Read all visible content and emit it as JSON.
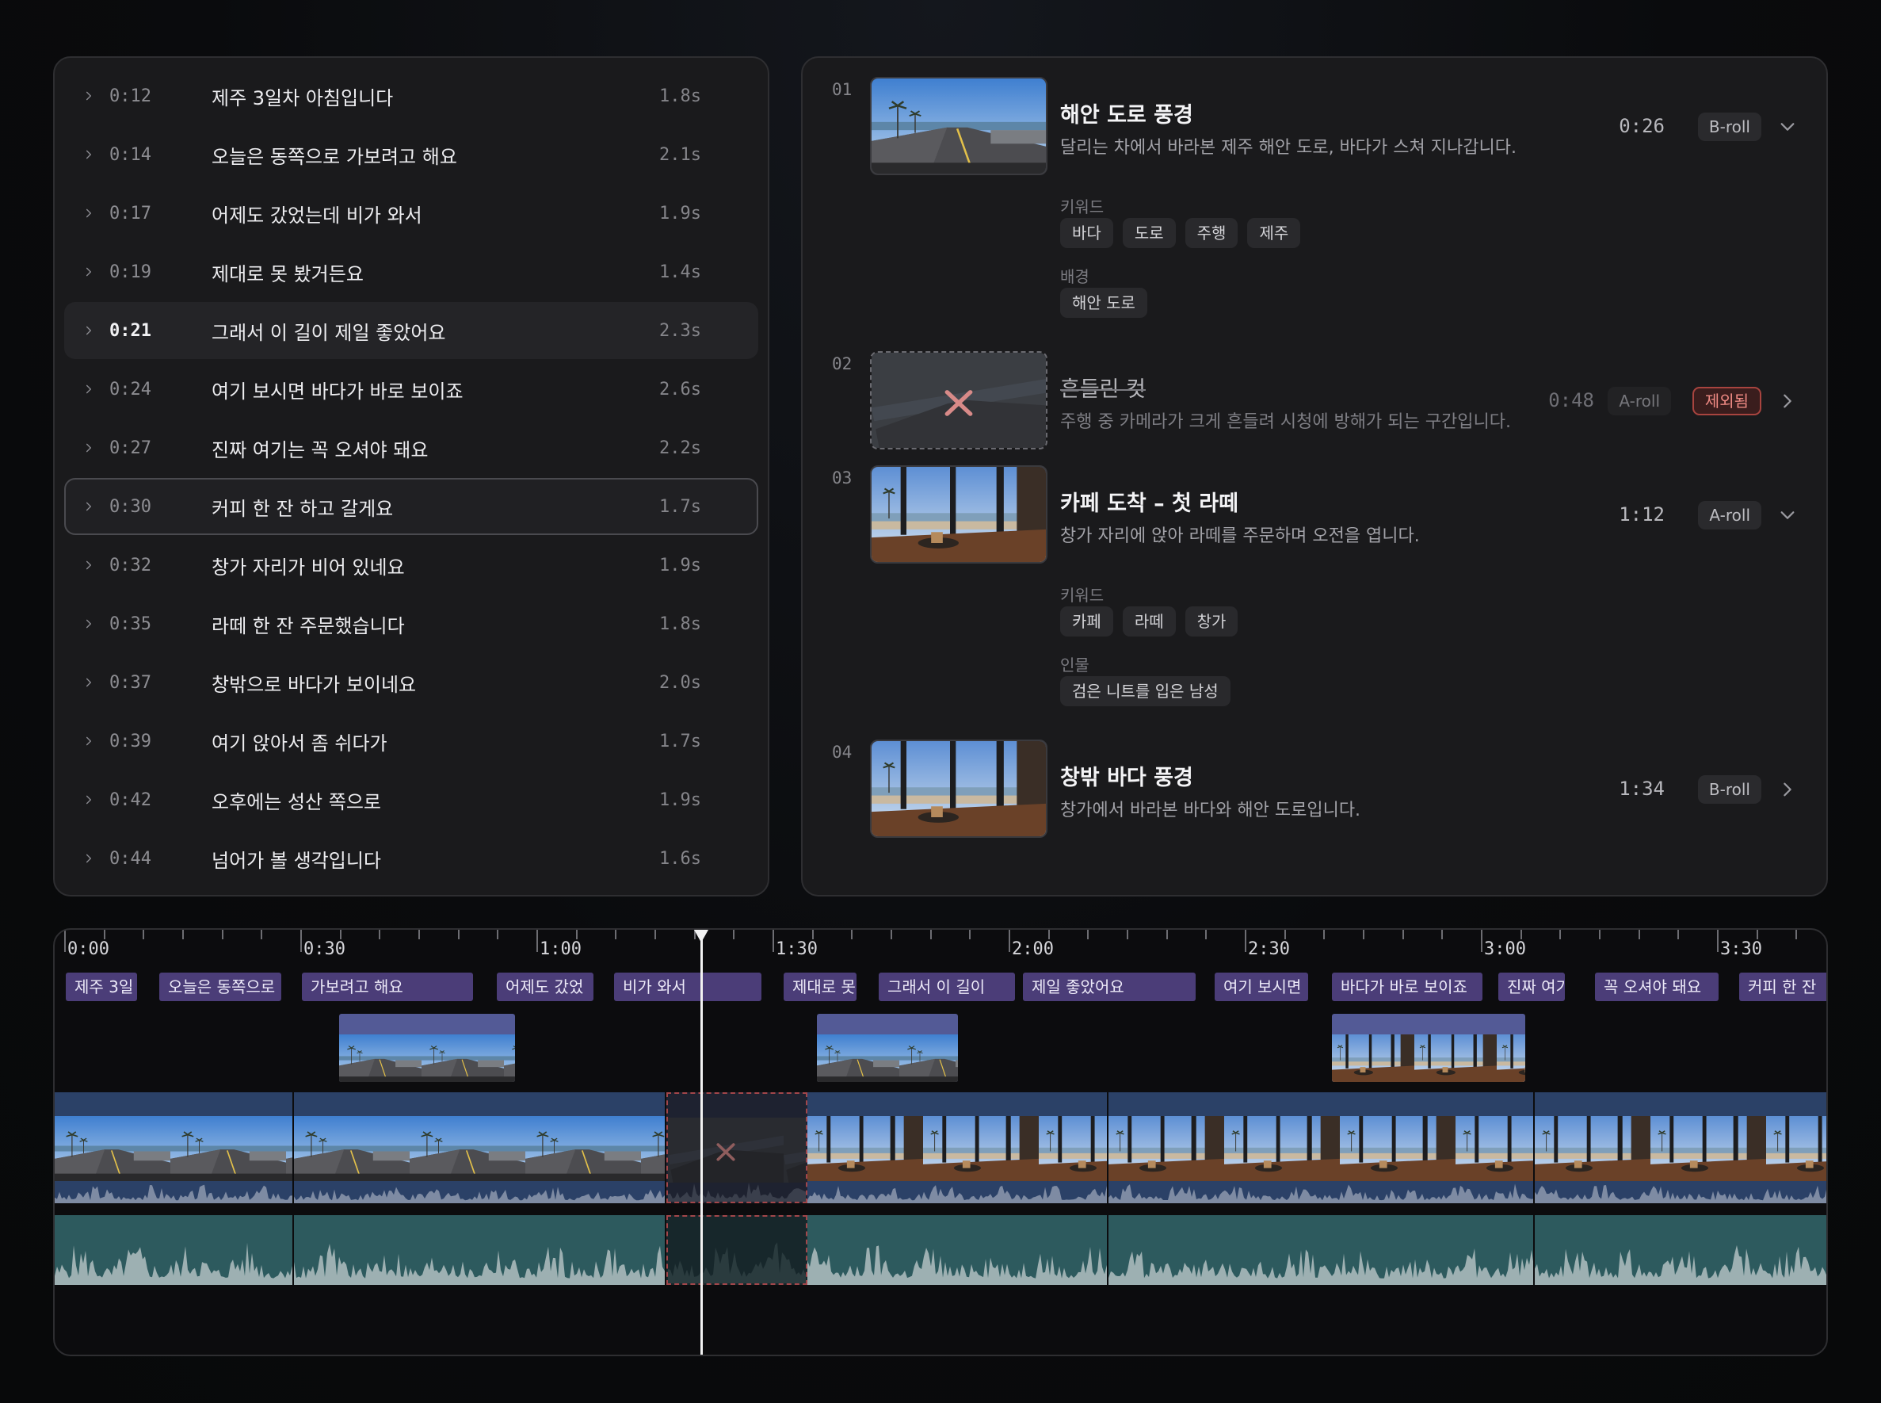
{
  "transcript": {
    "rows": [
      {
        "time": "0:12",
        "text": "제주 3일차 아침입니다",
        "dur": "1.8s",
        "state": ""
      },
      {
        "time": "0:14",
        "text": "오늘은 동쪽으로 가보려고 해요",
        "dur": "2.1s",
        "state": ""
      },
      {
        "time": "0:17",
        "text": "어제도 갔었는데 비가 와서",
        "dur": "1.9s",
        "state": ""
      },
      {
        "time": "0:19",
        "text": "제대로 못 봤거든요",
        "dur": "1.4s",
        "state": ""
      },
      {
        "time": "0:21",
        "text": "그래서 이 길이 제일 좋았어요",
        "dur": "2.3s",
        "state": "active"
      },
      {
        "time": "0:24",
        "text": "여기 보시면 바다가 바로 보이죠",
        "dur": "2.6s",
        "state": ""
      },
      {
        "time": "0:27",
        "text": "진짜 여기는 꼭 오셔야 돼요",
        "dur": "2.2s",
        "state": ""
      },
      {
        "time": "0:30",
        "text": "커피 한 잔 하고 갈게요",
        "dur": "1.7s",
        "state": "selected"
      },
      {
        "time": "0:32",
        "text": "창가 자리가 비어 있네요",
        "dur": "1.9s",
        "state": ""
      },
      {
        "time": "0:35",
        "text": "라떼 한 잔 주문했습니다",
        "dur": "1.8s",
        "state": ""
      },
      {
        "time": "0:37",
        "text": "창밖으로 바다가 보이네요",
        "dur": "2.0s",
        "state": ""
      },
      {
        "time": "0:39",
        "text": "여기 앉아서 좀 쉬다가",
        "dur": "1.7s",
        "state": ""
      },
      {
        "time": "0:42",
        "text": "오후에는 성산 쪽으로",
        "dur": "1.9s",
        "state": ""
      },
      {
        "time": "0:44",
        "text": "넘어가 볼 생각입니다",
        "dur": "1.6s",
        "state": ""
      }
    ]
  },
  "scenes": [
    {
      "num": "01",
      "title": "해안 도로 풍경",
      "desc": "달리는 차에서 바라본 제주 해안 도로, 바다가 스쳐 지나갑니다.",
      "time": "0:26",
      "type": "B-roll",
      "excluded_label": "",
      "expanded": true,
      "thumb": "road",
      "groups": [
        {
          "label": "키워드",
          "tags": [
            "바다",
            "도로",
            "주행",
            "제주"
          ]
        },
        {
          "label": "배경",
          "tags": [
            "해안 도로"
          ]
        }
      ]
    },
    {
      "num": "02",
      "title": "흔들린 컷",
      "desc": "주행 중 카메라가 크게 흔들려 시청에 방해가 되는 구간입니다.",
      "time": "0:48",
      "type": "A-roll",
      "excluded_label": "제외됨",
      "expanded": false,
      "thumb": "shaky",
      "groups": []
    },
    {
      "num": "03",
      "title": "카페 도착 – 첫 라떼",
      "desc": "창가 자리에 앉아 라떼를 주문하며 오전을 엽니다.",
      "time": "1:12",
      "type": "A-roll",
      "excluded_label": "",
      "expanded": true,
      "thumb": "cafe",
      "groups": [
        {
          "label": "키워드",
          "tags": [
            "카페",
            "라떼",
            "창가"
          ]
        },
        {
          "label": "인물",
          "tags": [
            "검은 니트를 입은 남성"
          ]
        }
      ]
    },
    {
      "num": "04",
      "title": "창밖 바다 풍경",
      "desc": "창가에서 바라본 바다와 해안 도로입니다.",
      "time": "1:34",
      "type": "B-roll",
      "excluded_label": "",
      "expanded": false,
      "thumb": "cafe",
      "groups": []
    }
  ],
  "timeline": {
    "ruler": [
      "0:00",
      "0:30",
      "1:00",
      "1:30",
      "2:00",
      "2:30",
      "3:00",
      "3:30"
    ],
    "captions": [
      "제주 3일",
      "오늘은 동쪽으로",
      "가보려고 해요",
      "어제도 갔었",
      "비가 와서",
      "제대로 못",
      "그래서 이 길이",
      "제일 좋았어요",
      "여기 보시면",
      "바다가 바로 보이죠",
      "진짜 여기",
      "꼭 오셔야 돼요",
      "커피 한 잔"
    ],
    "playhead": "1:10"
  },
  "colors": {
    "caption": "#4b3d78",
    "broll": "#535a96",
    "video": "#2b4167",
    "audio": "#2d5a5e",
    "excluded": "#a2464a"
  }
}
